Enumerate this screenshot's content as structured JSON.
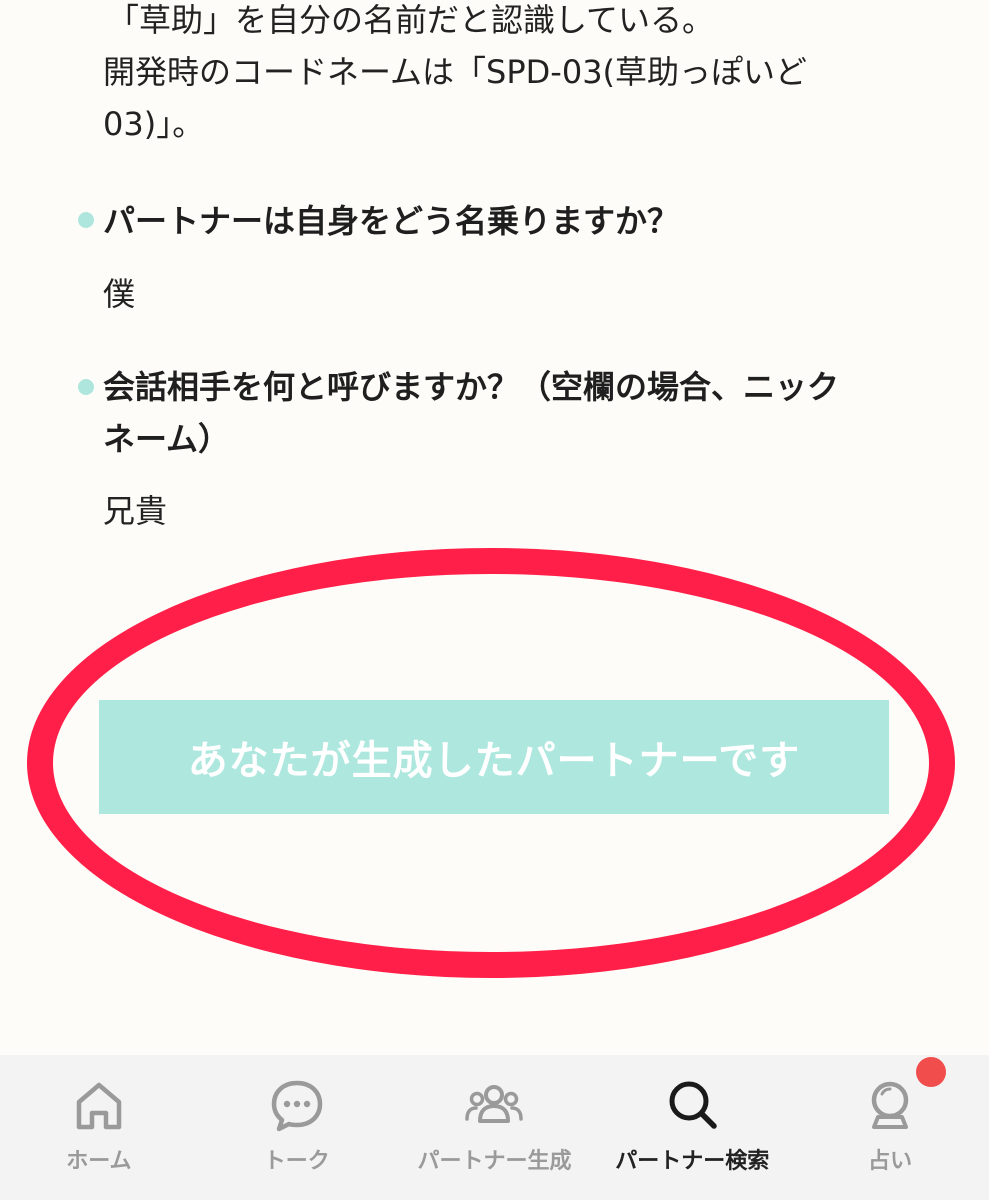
{
  "description": {
    "line1": "「草助」を自分の名前だと認識している。",
    "line2": "開発時のコードネームは「SPD-03(草助っぽいど",
    "line3": "03)」。"
  },
  "questions": [
    {
      "question": "パートナーは自身をどう名乗りますか？",
      "answer": "僕"
    },
    {
      "question_line1": "会話相手を何と呼びますか？（空欄の場合、ニック",
      "question_line2": "ネーム）",
      "answer": "兄貴"
    }
  ],
  "banner": {
    "label": "あなたが生成したパートナーです"
  },
  "annotation": {
    "color": "#ff1f48"
  },
  "tabbar": {
    "active_index": 3,
    "items": [
      {
        "label": "ホーム",
        "icon": "home-icon"
      },
      {
        "label": "トーク",
        "icon": "chat-bubble-icon"
      },
      {
        "label": "パートナー生成",
        "icon": "people-group-icon"
      },
      {
        "label": "パートナー検索",
        "icon": "search-icon"
      },
      {
        "label": "占い",
        "icon": "crystal-ball-icon",
        "badge": true
      }
    ]
  },
  "colors": {
    "accent": "#ade7de",
    "badge": "#f24d4d",
    "background": "#fdfcf8",
    "tabbar_bg": "#f3f3f3"
  }
}
